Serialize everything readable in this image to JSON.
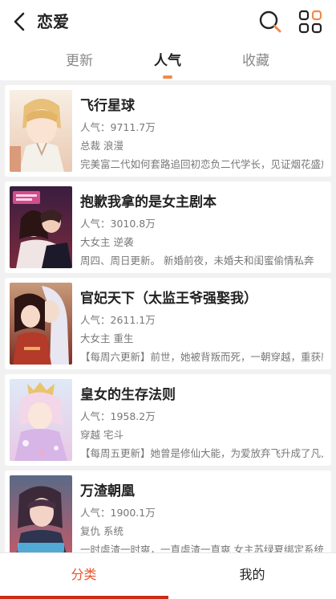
{
  "header": {
    "title": "恋爱"
  },
  "tabs": [
    {
      "label": "更新",
      "active": false
    },
    {
      "label": "人气",
      "active": true
    },
    {
      "label": "收藏",
      "active": false
    }
  ],
  "items": [
    {
      "title": "飞行星球",
      "popularity": "人气：9711.7万",
      "tags": "总裁 浪漫",
      "desc": "完美富二代如何套路追回初恋负二代学长，见证烟花盛放"
    },
    {
      "title": "抱歉我拿的是女主剧本",
      "popularity": "人气：3010.8万",
      "tags": "大女主 逆袭",
      "desc": "周四、周日更新。 新婚前夜，未婚夫和闺蜜偷情私奔"
    },
    {
      "title": "官妃天下（太监王爷强娶我）",
      "popularity": "人气：2611.1万",
      "tags": "大女主 重生",
      "desc": "【每周六更新】前世，她被背叛而死，一朝穿越，重获新生"
    },
    {
      "title": "皇女的生存法则",
      "popularity": "人气：1958.2万",
      "tags": "穿越 宅斗",
      "desc": "【每周五更新】她曾是修仙大能，为爱放弃飞升成了凡人"
    },
    {
      "title": "万渣朝凰",
      "popularity": "人气：1900.1万",
      "tags": "复仇 系统",
      "desc": "一时虐渣一时爽，一直虐渣一直爽 女主苏绿夏绑定系统"
    }
  ],
  "bottom_nav": [
    {
      "label": "分类",
      "active": true
    },
    {
      "label": "我的",
      "active": false
    }
  ],
  "colors": {
    "accent": "#e8552d",
    "indicator": "#f08a4b",
    "underline": "#cc2c17"
  },
  "icons": [
    "back-arrow-icon",
    "search-icon",
    "grid-menu-icon"
  ]
}
